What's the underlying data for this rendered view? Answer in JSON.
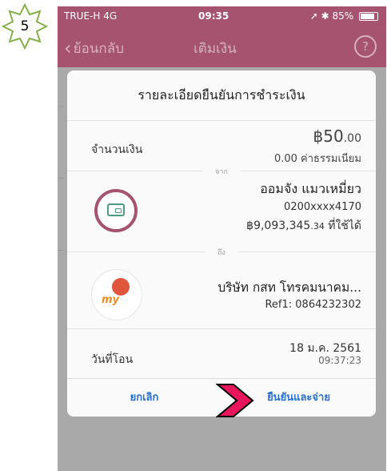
{
  "step_badge": {
    "number": "5"
  },
  "status_bar": {
    "carrier": "TRUE-H  4G",
    "time": "09:35",
    "battery": "85%"
  },
  "nav": {
    "back_label": "ย้อนกลับ",
    "title": "เติมเงิน",
    "help_icon": "?"
  },
  "dialog": {
    "title": "รายละเอียดยืนยันการชำระเงิน",
    "amount_label": "จำนวนเงิน",
    "amount_main": "฿50",
    "amount_decimal": ".00",
    "fee": "0.00 ค่าธรรมเนียม",
    "from_label": "จาก",
    "from": {
      "name": "ออมจัง แมวเหมี่ยว",
      "account": "0200xxxx4170",
      "balance_main": "฿9,093,345",
      "balance_decimal": ".34",
      "balance_suffix": " ที่ใช้ได้"
    },
    "to_label": "ถึง",
    "to": {
      "name": "บริษัท กสท โทรคมนาคม...",
      "ref": "Ref1: 0864232302"
    },
    "date_label": "วันที่โอน",
    "date": "18 ม.ค. 2561",
    "time": "09:37:23",
    "cancel_label": "ยกเลิก",
    "confirm_label": "ยืนยันและจ่าย"
  },
  "logo": {
    "text": "my"
  },
  "colors": {
    "brand": "#a5536e",
    "link": "#2a6fd0",
    "pointer": "#e8175d"
  }
}
